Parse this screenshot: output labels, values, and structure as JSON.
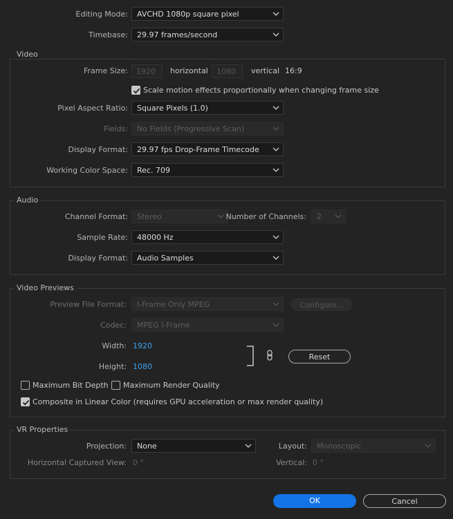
{
  "top": {
    "editing_mode_label": "Editing Mode:",
    "editing_mode_value": "AVCHD 1080p square pixel",
    "timebase_label": "Timebase:",
    "timebase_value": "29.97  frames/second"
  },
  "video": {
    "title": "Video",
    "frame_size_label": "Frame Size:",
    "frame_width": "1920",
    "horizontal_label": "horizontal",
    "frame_height": "1080",
    "vertical_label": "vertical",
    "aspect": "16:9",
    "scale_checkbox_label": "Scale motion effects proportionally when changing frame size",
    "scale_checked": true,
    "pixel_aspect_label": "Pixel Aspect Ratio:",
    "pixel_aspect_value": "Square Pixels (1.0)",
    "fields_label": "Fields:",
    "fields_value": "No Fields (Progressive Scan)",
    "display_format_label": "Display Format:",
    "display_format_value": "29.97 fps Drop-Frame Timecode",
    "color_space_label": "Working Color Space:",
    "color_space_value": "Rec. 709"
  },
  "audio": {
    "title": "Audio",
    "channel_format_label": "Channel Format:",
    "channel_format_value": "Stereo",
    "num_channels_label": "Number of Channels:",
    "num_channels_value": "2",
    "sample_rate_label": "Sample Rate:",
    "sample_rate_value": "48000 Hz",
    "display_format_label": "Display Format:",
    "display_format_value": "Audio Samples"
  },
  "previews": {
    "title": "Video Previews",
    "file_format_label": "Preview File Format:",
    "file_format_value": "I-Frame Only MPEG",
    "configure_label": "Configure...",
    "codec_label": "Codec:",
    "codec_value": "MPEG I-Frame",
    "width_label": "Width:",
    "width_value": "1920",
    "height_label": "Height:",
    "height_value": "1080",
    "reset_label": "Reset",
    "max_bit_depth_label": "Maximum Bit Depth",
    "max_bit_depth_checked": false,
    "max_render_quality_label": "Maximum Render Quality",
    "max_render_quality_checked": false,
    "linear_color_label": "Composite in Linear Color (requires GPU acceleration or max render quality)",
    "linear_color_checked": true
  },
  "vr": {
    "title": "VR Properties",
    "projection_label": "Projection:",
    "projection_value": "None",
    "layout_label": "Layout:",
    "layout_value": "Monoscopic",
    "h_view_label": "Horizontal Captured View:",
    "h_view_value": "0 °",
    "vertical_label": "Vertical:",
    "vertical_value": "0 °"
  },
  "buttons": {
    "ok_label": "OK",
    "cancel_label": "Cancel"
  },
  "colors": {
    "background": "#232323",
    "accent": "#1473e6",
    "link_value": "#3ea2f0"
  }
}
